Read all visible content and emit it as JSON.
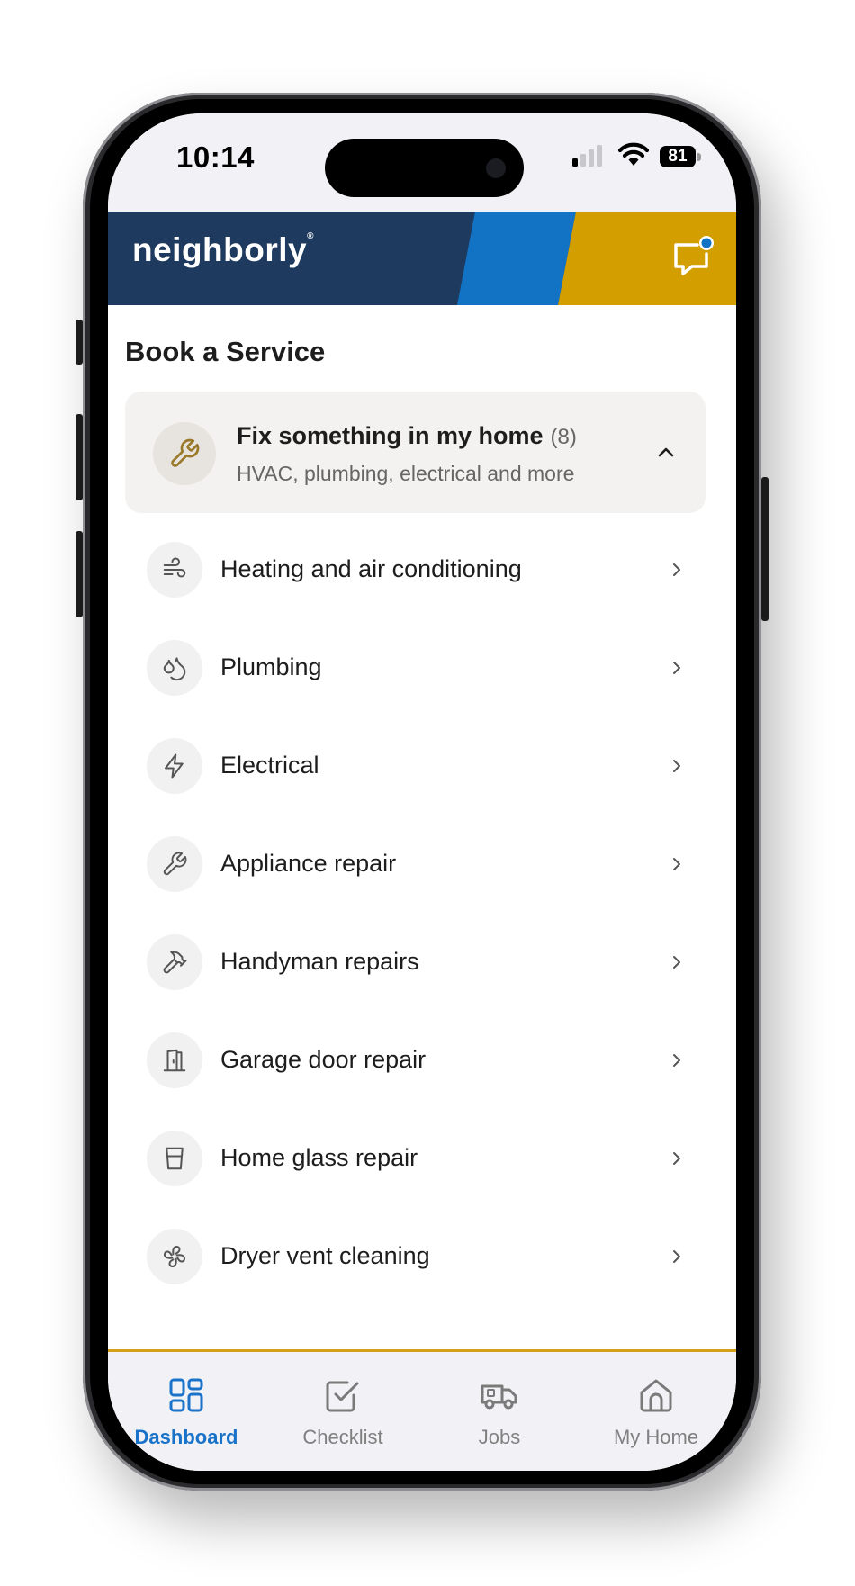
{
  "status_bar": {
    "time": "10:14",
    "battery": "81"
  },
  "header": {
    "logo_text": "neighborly",
    "logo_mark": "®",
    "message_icon": "message-square-icon",
    "brand_colors": {
      "navy": "#1e3a5f",
      "blue": "#1273c4",
      "gold": "#d39e00"
    }
  },
  "main": {
    "section_title": "Book a Service",
    "group": {
      "title": "Fix something in my home",
      "count": "(8)",
      "subtitle": "HVAC, plumbing, electrical and more",
      "icon": "wrench-icon",
      "expanded": true
    },
    "items": [
      {
        "label": "Heating and air conditioning",
        "icon": "wind-icon"
      },
      {
        "label": "Plumbing",
        "icon": "droplets-icon"
      },
      {
        "label": "Electrical",
        "icon": "lightning-icon"
      },
      {
        "label": "Appliance repair",
        "icon": "wrench-icon"
      },
      {
        "label": "Handyman repairs",
        "icon": "hammer-icon"
      },
      {
        "label": "Garage door repair",
        "icon": "door-icon"
      },
      {
        "label": "Home glass repair",
        "icon": "glass-icon"
      },
      {
        "label": "Dryer vent cleaning",
        "icon": "fan-icon"
      }
    ]
  },
  "tabbar": {
    "accent": "#1a73c8",
    "tabs": [
      {
        "label": "Dashboard",
        "icon": "dashboard-grid-icon",
        "active": true
      },
      {
        "label": "Checklist",
        "icon": "checkbox-icon",
        "active": false
      },
      {
        "label": "Jobs",
        "icon": "truck-icon",
        "active": false
      },
      {
        "label": "My Home",
        "icon": "house-icon",
        "active": false
      }
    ]
  }
}
